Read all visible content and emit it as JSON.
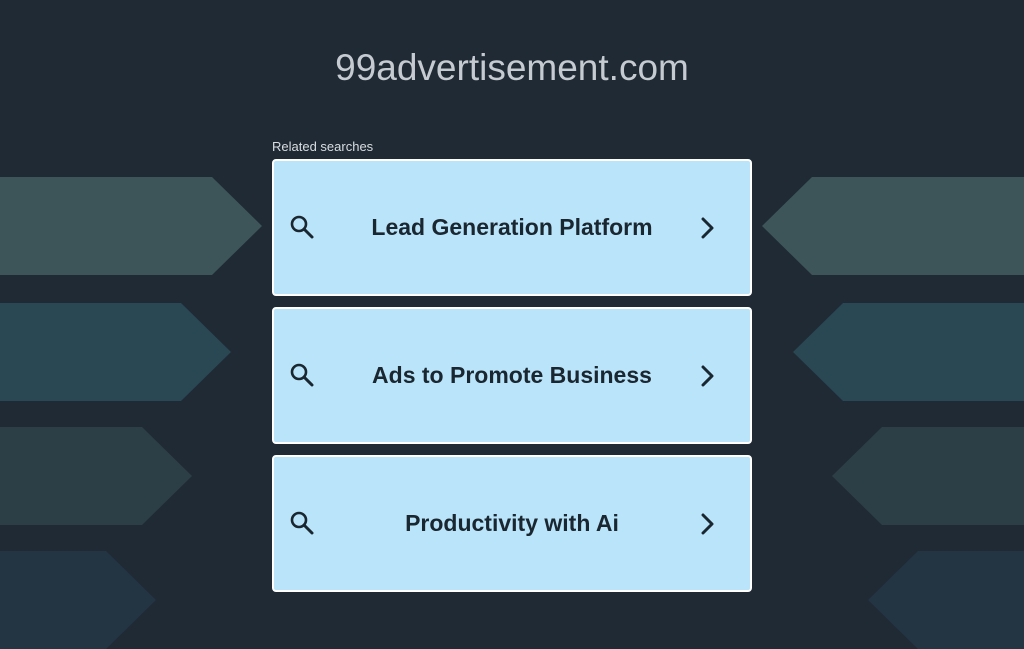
{
  "site": {
    "title": "99advertisement.com"
  },
  "related": {
    "label": "Related searches",
    "items": [
      {
        "label": "Lead Generation Platform"
      },
      {
        "label": "Ads to Promote Business"
      },
      {
        "label": "Productivity with Ai"
      }
    ]
  },
  "colors": {
    "background": "#1f2a34",
    "card": "#b9e4f9",
    "card_border": "#ffffff",
    "card_text": "#1a2630",
    "title_text": "#c5cbd0",
    "arrows": [
      "#3d5559",
      "#2a4754",
      "#2c3f46",
      "#233543"
    ]
  }
}
